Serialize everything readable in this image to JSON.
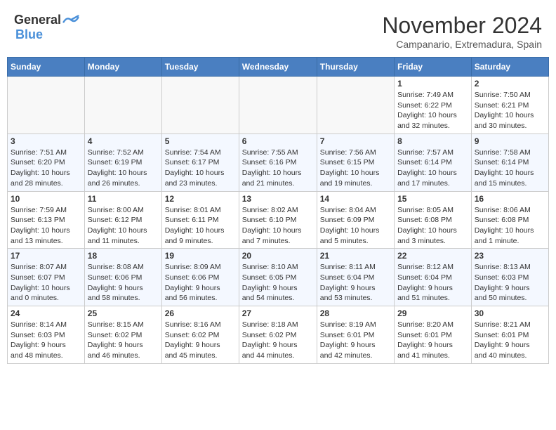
{
  "header": {
    "logo_general": "General",
    "logo_blue": "Blue",
    "month": "November 2024",
    "location": "Campanario, Extremadura, Spain"
  },
  "weekdays": [
    "Sunday",
    "Monday",
    "Tuesday",
    "Wednesday",
    "Thursday",
    "Friday",
    "Saturday"
  ],
  "weeks": [
    [
      {
        "day": "",
        "info": ""
      },
      {
        "day": "",
        "info": ""
      },
      {
        "day": "",
        "info": ""
      },
      {
        "day": "",
        "info": ""
      },
      {
        "day": "",
        "info": ""
      },
      {
        "day": "1",
        "info": "Sunrise: 7:49 AM\nSunset: 6:22 PM\nDaylight: 10 hours\nand 32 minutes."
      },
      {
        "day": "2",
        "info": "Sunrise: 7:50 AM\nSunset: 6:21 PM\nDaylight: 10 hours\nand 30 minutes."
      }
    ],
    [
      {
        "day": "3",
        "info": "Sunrise: 7:51 AM\nSunset: 6:20 PM\nDaylight: 10 hours\nand 28 minutes."
      },
      {
        "day": "4",
        "info": "Sunrise: 7:52 AM\nSunset: 6:19 PM\nDaylight: 10 hours\nand 26 minutes."
      },
      {
        "day": "5",
        "info": "Sunrise: 7:54 AM\nSunset: 6:17 PM\nDaylight: 10 hours\nand 23 minutes."
      },
      {
        "day": "6",
        "info": "Sunrise: 7:55 AM\nSunset: 6:16 PM\nDaylight: 10 hours\nand 21 minutes."
      },
      {
        "day": "7",
        "info": "Sunrise: 7:56 AM\nSunset: 6:15 PM\nDaylight: 10 hours\nand 19 minutes."
      },
      {
        "day": "8",
        "info": "Sunrise: 7:57 AM\nSunset: 6:14 PM\nDaylight: 10 hours\nand 17 minutes."
      },
      {
        "day": "9",
        "info": "Sunrise: 7:58 AM\nSunset: 6:14 PM\nDaylight: 10 hours\nand 15 minutes."
      }
    ],
    [
      {
        "day": "10",
        "info": "Sunrise: 7:59 AM\nSunset: 6:13 PM\nDaylight: 10 hours\nand 13 minutes."
      },
      {
        "day": "11",
        "info": "Sunrise: 8:00 AM\nSunset: 6:12 PM\nDaylight: 10 hours\nand 11 minutes."
      },
      {
        "day": "12",
        "info": "Sunrise: 8:01 AM\nSunset: 6:11 PM\nDaylight: 10 hours\nand 9 minutes."
      },
      {
        "day": "13",
        "info": "Sunrise: 8:02 AM\nSunset: 6:10 PM\nDaylight: 10 hours\nand 7 minutes."
      },
      {
        "day": "14",
        "info": "Sunrise: 8:04 AM\nSunset: 6:09 PM\nDaylight: 10 hours\nand 5 minutes."
      },
      {
        "day": "15",
        "info": "Sunrise: 8:05 AM\nSunset: 6:08 PM\nDaylight: 10 hours\nand 3 minutes."
      },
      {
        "day": "16",
        "info": "Sunrise: 8:06 AM\nSunset: 6:08 PM\nDaylight: 10 hours\nand 1 minute."
      }
    ],
    [
      {
        "day": "17",
        "info": "Sunrise: 8:07 AM\nSunset: 6:07 PM\nDaylight: 10 hours\nand 0 minutes."
      },
      {
        "day": "18",
        "info": "Sunrise: 8:08 AM\nSunset: 6:06 PM\nDaylight: 9 hours\nand 58 minutes."
      },
      {
        "day": "19",
        "info": "Sunrise: 8:09 AM\nSunset: 6:06 PM\nDaylight: 9 hours\nand 56 minutes."
      },
      {
        "day": "20",
        "info": "Sunrise: 8:10 AM\nSunset: 6:05 PM\nDaylight: 9 hours\nand 54 minutes."
      },
      {
        "day": "21",
        "info": "Sunrise: 8:11 AM\nSunset: 6:04 PM\nDaylight: 9 hours\nand 53 minutes."
      },
      {
        "day": "22",
        "info": "Sunrise: 8:12 AM\nSunset: 6:04 PM\nDaylight: 9 hours\nand 51 minutes."
      },
      {
        "day": "23",
        "info": "Sunrise: 8:13 AM\nSunset: 6:03 PM\nDaylight: 9 hours\nand 50 minutes."
      }
    ],
    [
      {
        "day": "24",
        "info": "Sunrise: 8:14 AM\nSunset: 6:03 PM\nDaylight: 9 hours\nand 48 minutes."
      },
      {
        "day": "25",
        "info": "Sunrise: 8:15 AM\nSunset: 6:02 PM\nDaylight: 9 hours\nand 46 minutes."
      },
      {
        "day": "26",
        "info": "Sunrise: 8:16 AM\nSunset: 6:02 PM\nDaylight: 9 hours\nand 45 minutes."
      },
      {
        "day": "27",
        "info": "Sunrise: 8:18 AM\nSunset: 6:02 PM\nDaylight: 9 hours\nand 44 minutes."
      },
      {
        "day": "28",
        "info": "Sunrise: 8:19 AM\nSunset: 6:01 PM\nDaylight: 9 hours\nand 42 minutes."
      },
      {
        "day": "29",
        "info": "Sunrise: 8:20 AM\nSunset: 6:01 PM\nDaylight: 9 hours\nand 41 minutes."
      },
      {
        "day": "30",
        "info": "Sunrise: 8:21 AM\nSunset: 6:01 PM\nDaylight: 9 hours\nand 40 minutes."
      }
    ]
  ]
}
